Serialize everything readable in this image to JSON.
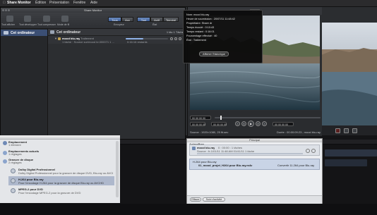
{
  "menubar": {
    "apple": "",
    "app": "Share Monitor",
    "items": [
      "Édition",
      "Présentation",
      "Fenêtre",
      "Aide"
    ]
  },
  "share_monitor": {
    "title": "Share Monitor",
    "toolbar_left": [
      {
        "label": "Tout afficher",
        "icon": "list-icon"
      },
      {
        "label": "Tout développer",
        "icon": "expand-icon"
      },
      {
        "label": "Tout compresser",
        "icon": "collapse-icon"
      },
      {
        "label": "Mode de fil",
        "icon": "thread-icon"
      }
    ],
    "filter_buttons": [
      "Tous",
      "Acc"
    ],
    "status_buttons": [
      "Tout",
      "Actif",
      "Terminé"
    ],
    "filter_caption": "Envoyeur",
    "status_caption": "État",
    "sidebar": {
      "items": [
        {
          "label": "Cet ordinateur",
          "icon": "computer-icon"
        }
      ]
    },
    "group": {
      "name": "Cet ordinateur",
      "count": "1 tâc 1 Tâche"
    },
    "job": {
      "name": "mood blu-ray",
      "status": "Traitement",
      "detail": "1 tâche · Source sur/mood br.000071 1 …",
      "time": "0:16:16 restants",
      "progress": 0.42
    }
  },
  "hud": {
    "lines": [
      "Nom: mood blu-ray",
      "Heure de soumission : 20/07/11 11:48:42",
      "Propriétaire: Share dr",
      "Temps écoulé : 0:10:43",
      "Temps restant : 0:16:01",
      "Pourcentage effectué : 40",
      "État : Traitement"
    ],
    "button": "Afficher l'historique"
  },
  "viewer": {
    "zoom": "83%",
    "timecode_in": "00 00 00 00",
    "timecode_out": "00 00 00 00",
    "timecode_a": "00 00 00 00",
    "timecode_b": "00 00 00 00",
    "source_info": "Source : 1920×1080, 25 fit.sec",
    "output_info": "Durée : 00:00:09:23 ; mood blu-ray",
    "playhead": 0.05,
    "right_tools": [
      "crop-icon",
      "grid-icon",
      "sound-icon"
    ]
  },
  "batch_settings": {
    "categories": [
      {
        "label": "Emplacement",
        "detail": "1 élément"
      },
      {
        "label": "Emplacements",
        "detail": "réglages"
      }
    ],
    "groups": [
      {
        "label": "Emplacements actuels",
        "detail": "1 réglages"
      },
      {
        "label": "Gravure de disque",
        "detail": "2 réglages"
      }
    ],
    "items": [
      {
        "title": "Dolby Digital Professionnel",
        "desc": "Dolby Digital Professionnel pour la gravure de disque DVD, Blu-ray ou AVCHD",
        "selected": false
      },
      {
        "title": "H.264 pour Blu-ray",
        "desc": "Pour l'encodage H.264 pour la gravure de disque Blu-ray ou AVCHD",
        "selected": true
      },
      {
        "title": "MPEG-2 pour DVD",
        "desc": "Pour l'encodage MPEG-2 pour la gravure de DVD",
        "selected": false
      }
    ]
  },
  "batch_window": {
    "title": "Principal",
    "header": "AutresPres",
    "row1": {
      "name": "mood blu-ray",
      "sub": "0 : 00:00 : 1 tâches",
      "sub2": "Source : fr-1/01/11 11:48 AM 01/41/11 1 tâche",
      "pct": "Valeur actuelle : 0,0%"
    },
    "row2": {
      "name": "01_mood_projet_H264 pour Blu-ray.m4v",
      "detail": "H.264 pour Blu-ray",
      "dest": "01_mood_projet_H264 Hbt.mt pour Blu-ray.264",
      "right": "Convertir 11.264 pour Blu-ray"
    },
    "bottom": [
      "Effacer",
      "Suivi d'activité"
    ],
    "bottom_right": "Nouveau l'éditeur de lot"
  }
}
